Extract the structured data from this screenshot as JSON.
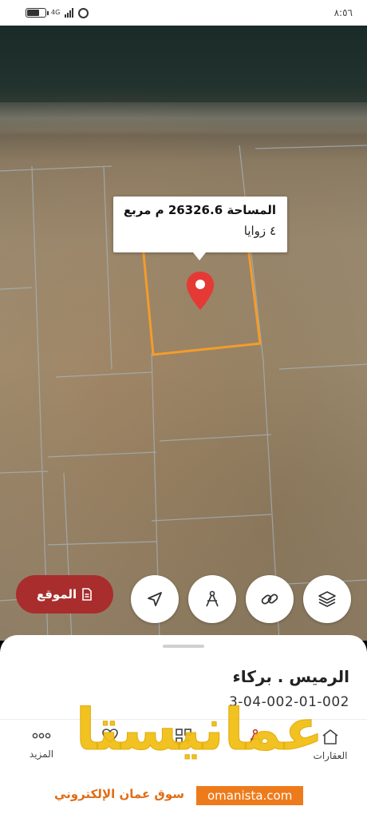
{
  "status_bar": {
    "time": "٨:٥٦",
    "network": "4G"
  },
  "map": {
    "tooltip": {
      "area": "المساحة 26326.6 م مربع",
      "corners": "٤ زوايا"
    },
    "parcel_color": "#f39c2b",
    "pin_color": "#e53935"
  },
  "controls": {
    "location_button": "الموقع",
    "buttons": [
      "navigate-icon",
      "measure-icon",
      "link-icon",
      "layers-icon"
    ]
  },
  "sheet": {
    "place_name": "الرميس . بركاء",
    "place_code": "3-04-002-01-002"
  },
  "nav": {
    "more": "المزيد",
    "properties": "العقارات"
  },
  "watermark": {
    "brand": "عمانيستا",
    "tagline": "سوق عمان الإلكتروني",
    "domain": "omanista.com"
  }
}
